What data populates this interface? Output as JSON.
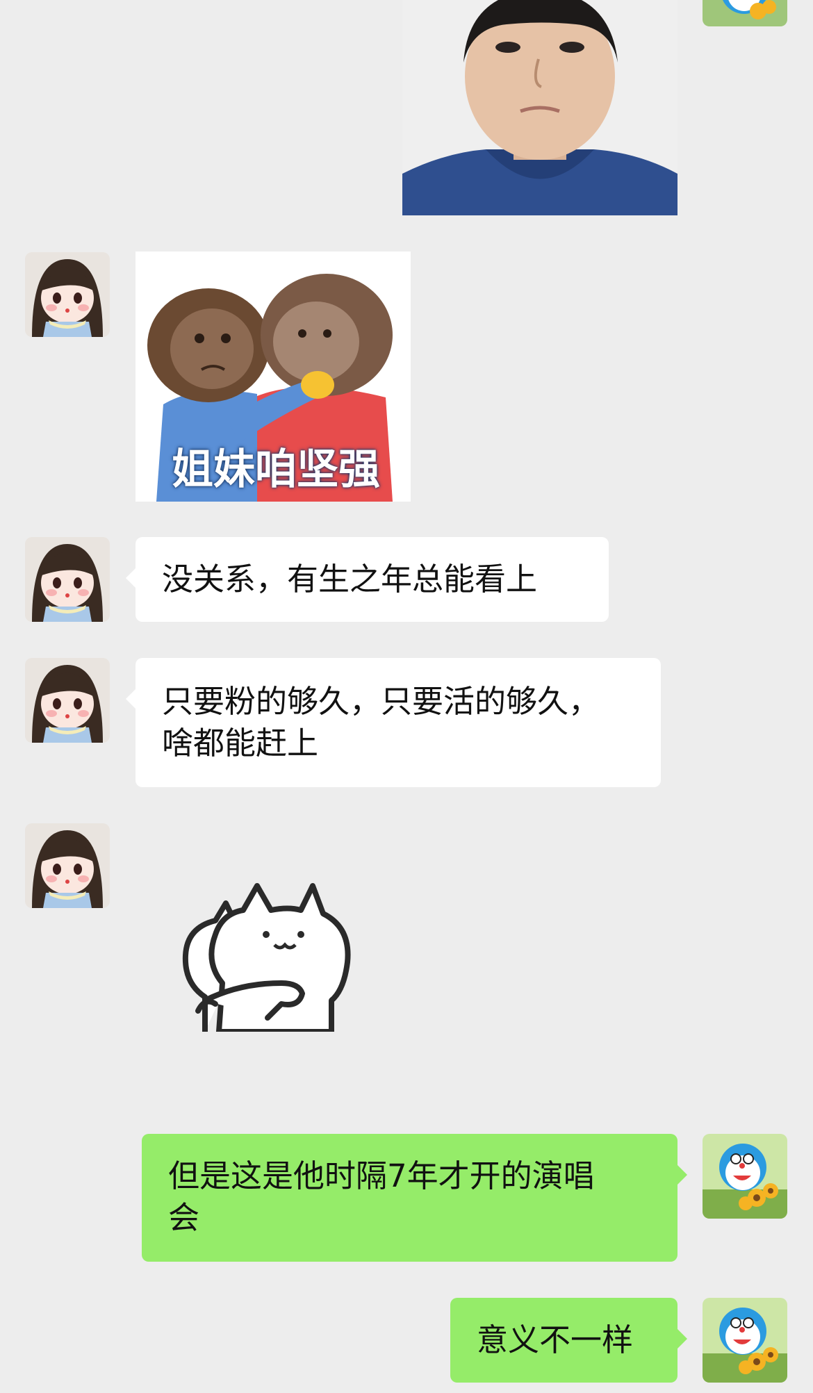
{
  "messages": [
    {
      "id": "m1",
      "side": "right",
      "type": "image",
      "image": "boy-photo"
    },
    {
      "id": "m2",
      "side": "left",
      "type": "sticker",
      "image": "monkeys-hug-sticker",
      "caption": "姐妹咱坚强"
    },
    {
      "id": "m3",
      "side": "left",
      "type": "text",
      "lines": [
        "没关系，有生之年总能看上"
      ]
    },
    {
      "id": "m4",
      "side": "left",
      "type": "text",
      "lines": [
        "只要粉的够久，只要活的够久，",
        "啥都能赶上"
      ]
    },
    {
      "id": "m5",
      "side": "left",
      "type": "sticker",
      "image": "cat-pat-sticker"
    },
    {
      "id": "m6",
      "side": "right",
      "type": "text",
      "lines": [
        "但是这是他时隔7年才开的演唱",
        "会"
      ]
    },
    {
      "id": "m7",
      "side": "right",
      "type": "text",
      "lines": [
        "意义不一样"
      ]
    }
  ],
  "avatars": {
    "left": "girl-doll-avatar",
    "right": "doraemon-sunflower-avatar"
  },
  "colors": {
    "background": "#ededed",
    "incoming_bubble": "#ffffff",
    "outgoing_bubble": "#95ec69"
  }
}
